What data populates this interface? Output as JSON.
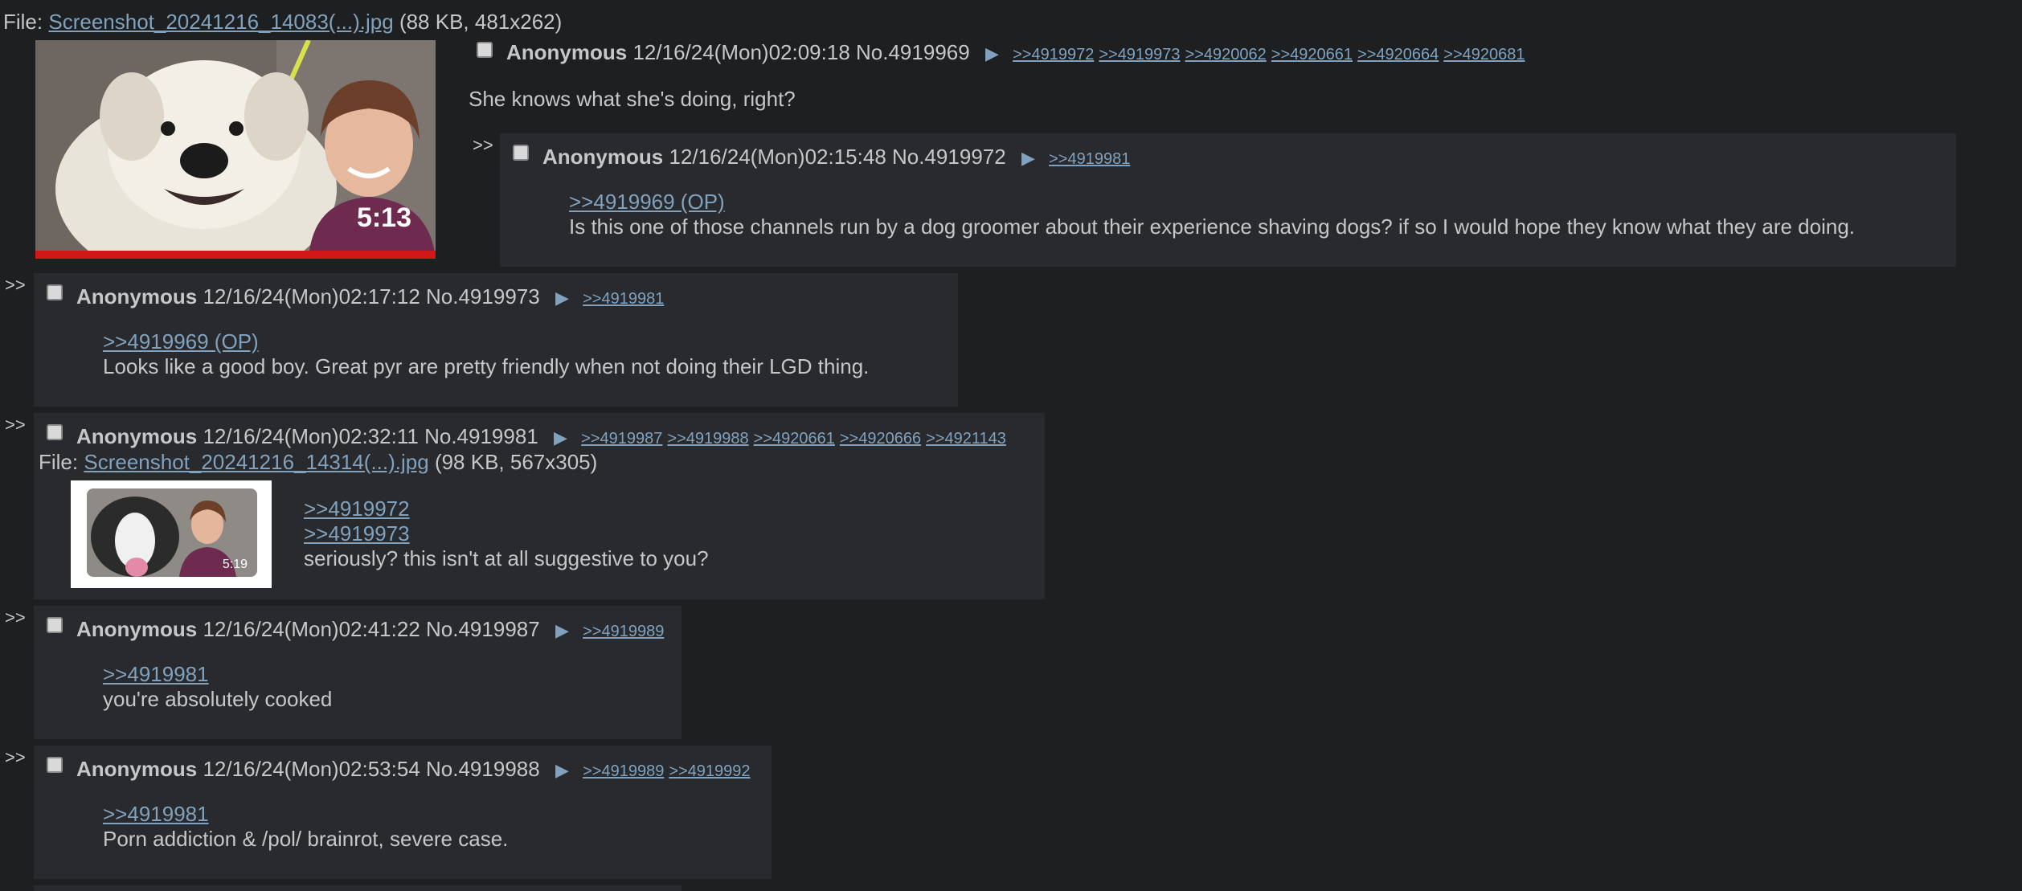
{
  "op": {
    "file_prefix": "File:",
    "file_name": "Screenshot_20241216_14083(...).jpg",
    "file_meta": "(88 KB, 481x262)",
    "thumb_duration": "5:13",
    "name": "Anonymous",
    "datetime": "12/16/24(Mon)02:09:18",
    "number": "No.4919969",
    "backlinks": [
      ">>4919972",
      ">>4919973",
      ">>4920062",
      ">>4920661",
      ">>4920664",
      ">>4920681"
    ],
    "message": "She knows what she's doing, right?"
  },
  "replies": [
    {
      "arrows": ">>",
      "name": "Anonymous",
      "datetime": "12/16/24(Mon)02:15:48",
      "number": "No.4919972",
      "backlinks": [
        ">>4919981"
      ],
      "quotes": [
        ">>4919969 (OP)"
      ],
      "message": "Is this one of those channels run by a dog groomer about their experience shaving dogs? if so I would hope they know what they are doing."
    },
    {
      "arrows": ">>",
      "name": "Anonymous",
      "datetime": "12/16/24(Mon)02:17:12",
      "number": "No.4919973",
      "backlinks": [
        ">>4919981"
      ],
      "quotes": [
        ">>4919969 (OP)"
      ],
      "message": "Looks like a good boy. Great pyr are pretty friendly when not doing their LGD thing."
    },
    {
      "arrows": ">>",
      "name": "Anonymous",
      "datetime": "12/16/24(Mon)02:32:11",
      "number": "No.4919981",
      "backlinks": [
        ">>4919987",
        ">>4919988",
        ">>4920661",
        ">>4920666",
        ">>4921143"
      ],
      "file_prefix": "File:",
      "file_name": "Screenshot_20241216_14314(...).jpg",
      "file_meta": "(98 KB, 567x305)",
      "thumb_duration": "5:19",
      "quotes": [
        ">>4919972",
        ">>4919973"
      ],
      "message": "seriously? this isn't at all suggestive to you?"
    },
    {
      "arrows": ">>",
      "name": "Anonymous",
      "datetime": "12/16/24(Mon)02:41:22",
      "number": "No.4919987",
      "backlinks": [
        ">>4919989"
      ],
      "quotes": [
        ">>4919981"
      ],
      "message": "you're absolutely cooked"
    },
    {
      "arrows": ">>",
      "name": "Anonymous",
      "datetime": "12/16/24(Mon)02:53:54",
      "number": "No.4919988",
      "backlinks": [
        ">>4919989",
        ">>4919992"
      ],
      "quotes": [
        ">>4919981"
      ],
      "message": "Porn addiction & /pol/ brainrot, severe case."
    }
  ],
  "colors": {
    "background": "#1d1f21",
    "post_background": "#282a2e",
    "text": "#c5c8c6",
    "link": "#81a2be"
  }
}
